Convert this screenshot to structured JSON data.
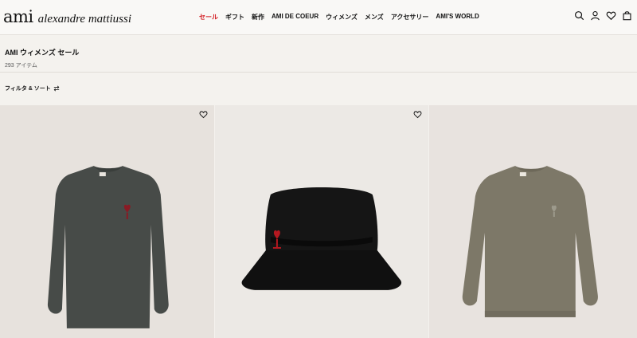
{
  "brand": {
    "name": "ami",
    "sub": "alexandre mattiussi"
  },
  "nav": {
    "items": [
      "セール",
      "ギフト",
      "新作",
      "AMI DE COEUR",
      "ウィメンズ",
      "メンズ",
      "アクセサリー",
      "AMI'S WORLD"
    ],
    "active_color": "#d2191f"
  },
  "header_icons": [
    "search-icon",
    "account-icon",
    "wishlist-icon",
    "bag-icon"
  ],
  "page": {
    "title": "AMI ウィメンズ セール",
    "count": "293 アイテム"
  },
  "filter": {
    "label": "フィルタ & ソート"
  },
  "products": [
    {
      "type": "sweater",
      "color": "#474b48",
      "wishlist": true
    },
    {
      "type": "bucket-hat",
      "color": "#151515",
      "wishlist": true
    },
    {
      "type": "sweatshirt",
      "color": "#7d7868",
      "wishlist": false
    }
  ]
}
